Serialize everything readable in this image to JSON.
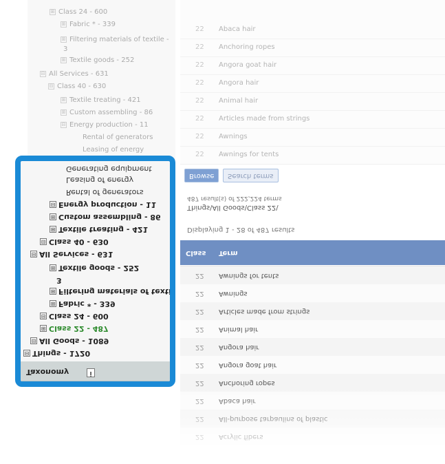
{
  "top_tree": {
    "nodes": [
      {
        "label": "Class 24 - 600",
        "toggle": "⊞"
      },
      {
        "label": "Fabric * - 339",
        "toggle": "⊞"
      },
      {
        "label": "Filtering materials of textile -",
        "toggle": "⊞"
      },
      {
        "label": "3",
        "toggle": ""
      },
      {
        "label": "Textile goods - 252",
        "toggle": "⊞"
      },
      {
        "label": "All Services - 631",
        "toggle": "⊟"
      },
      {
        "label": "Class 40 - 630",
        "toggle": "⊟"
      },
      {
        "label": "Textile treating - 421",
        "toggle": "⊞"
      },
      {
        "label": "Custom assembling - 86",
        "toggle": "⊞"
      },
      {
        "label": "Energy production - 11",
        "toggle": "⊟"
      },
      {
        "label": "Rental of generators",
        "toggle": ""
      },
      {
        "label": "Leasing of energy",
        "toggle": ""
      }
    ]
  },
  "top_table": {
    "rows": [
      {
        "cls": "22",
        "term": "Abaca hair"
      },
      {
        "cls": "22",
        "term": "Anchoring ropes"
      },
      {
        "cls": "22",
        "term": "Angora goat hair"
      },
      {
        "cls": "22",
        "term": "Angora hair"
      },
      {
        "cls": "22",
        "term": "Animal hair"
      },
      {
        "cls": "22",
        "term": "Articles made from strings"
      },
      {
        "cls": "22",
        "term": "Awnings"
      },
      {
        "cls": "22",
        "term": "Awnings for tents"
      },
      {
        "cls": "22",
        "term": "Awnings for tents"
      }
    ]
  },
  "taxonomy": {
    "header": "Taxonomy",
    "info_icon": "i",
    "nodes": [
      {
        "label": "Things - 1720",
        "toggle": "⊟",
        "style": "bold"
      },
      {
        "label": "All Goods - 1089",
        "toggle": "⊟",
        "style": "bold"
      },
      {
        "label": "Class 22 - 487",
        "toggle": "⊞",
        "style": "green"
      },
      {
        "label": "Class 24 - 600",
        "toggle": "⊟",
        "style": "bold"
      },
      {
        "label": "Fabric * - 339",
        "toggle": "⊞",
        "style": "bold"
      },
      {
        "label": "Filtering materials of textile -",
        "toggle": "⊞",
        "style": "bold"
      },
      {
        "label": "3",
        "toggle": "",
        "style": "bold"
      },
      {
        "label": "Textile goods - 252",
        "toggle": "⊞",
        "style": "bold"
      },
      {
        "label": "All Services - 631",
        "toggle": "⊟",
        "style": "bold"
      },
      {
        "label": "Class 40 - 630",
        "toggle": "⊟",
        "style": "bold"
      },
      {
        "label": "Textile treating - 421",
        "toggle": "⊞",
        "style": "bold"
      },
      {
        "label": "Custom assembling - 86",
        "toggle": "⊞",
        "style": "bold"
      },
      {
        "label": "Energy production - 11",
        "toggle": "⊟",
        "style": "bold"
      },
      {
        "label": "Rental of generators",
        "toggle": "",
        "style": "thin"
      },
      {
        "label": "Leasing of energy",
        "toggle": "",
        "style": "thin"
      },
      {
        "label": "Generating equipment",
        "toggle": "",
        "style": "thin"
      }
    ]
  },
  "results": {
    "header_class": "Class",
    "header_term": "Term",
    "rows": [
      {
        "cls": "22",
        "term": "Acrylic fibers"
      },
      {
        "cls": "22",
        "term": "All-purpose tarpaulins of plastic"
      },
      {
        "cls": "22",
        "term": "Abaca hair"
      },
      {
        "cls": "22",
        "term": "Anchoring ropes"
      },
      {
        "cls": "22",
        "term": "Angora goat hair"
      },
      {
        "cls": "22",
        "term": "Angora hair"
      },
      {
        "cls": "22",
        "term": "Animal hair"
      },
      {
        "cls": "22",
        "term": "Articles made from strings"
      },
      {
        "cls": "22",
        "term": "Awnings"
      },
      {
        "cls": "22",
        "term": "Awnings for tents"
      }
    ],
    "displaying": "Displaying 1 - 28 of 487 results",
    "path": "Things\\All Goods\\Class 22\\",
    "result_count": "487 result(s) of 222,224 terms",
    "btn_primary": "Browse",
    "btn_secondary": "Search terms"
  },
  "colors": {
    "highlight_border": "#1a8ad6",
    "table_header": "#6f8fc3",
    "green_node": "#2e8b2e"
  }
}
